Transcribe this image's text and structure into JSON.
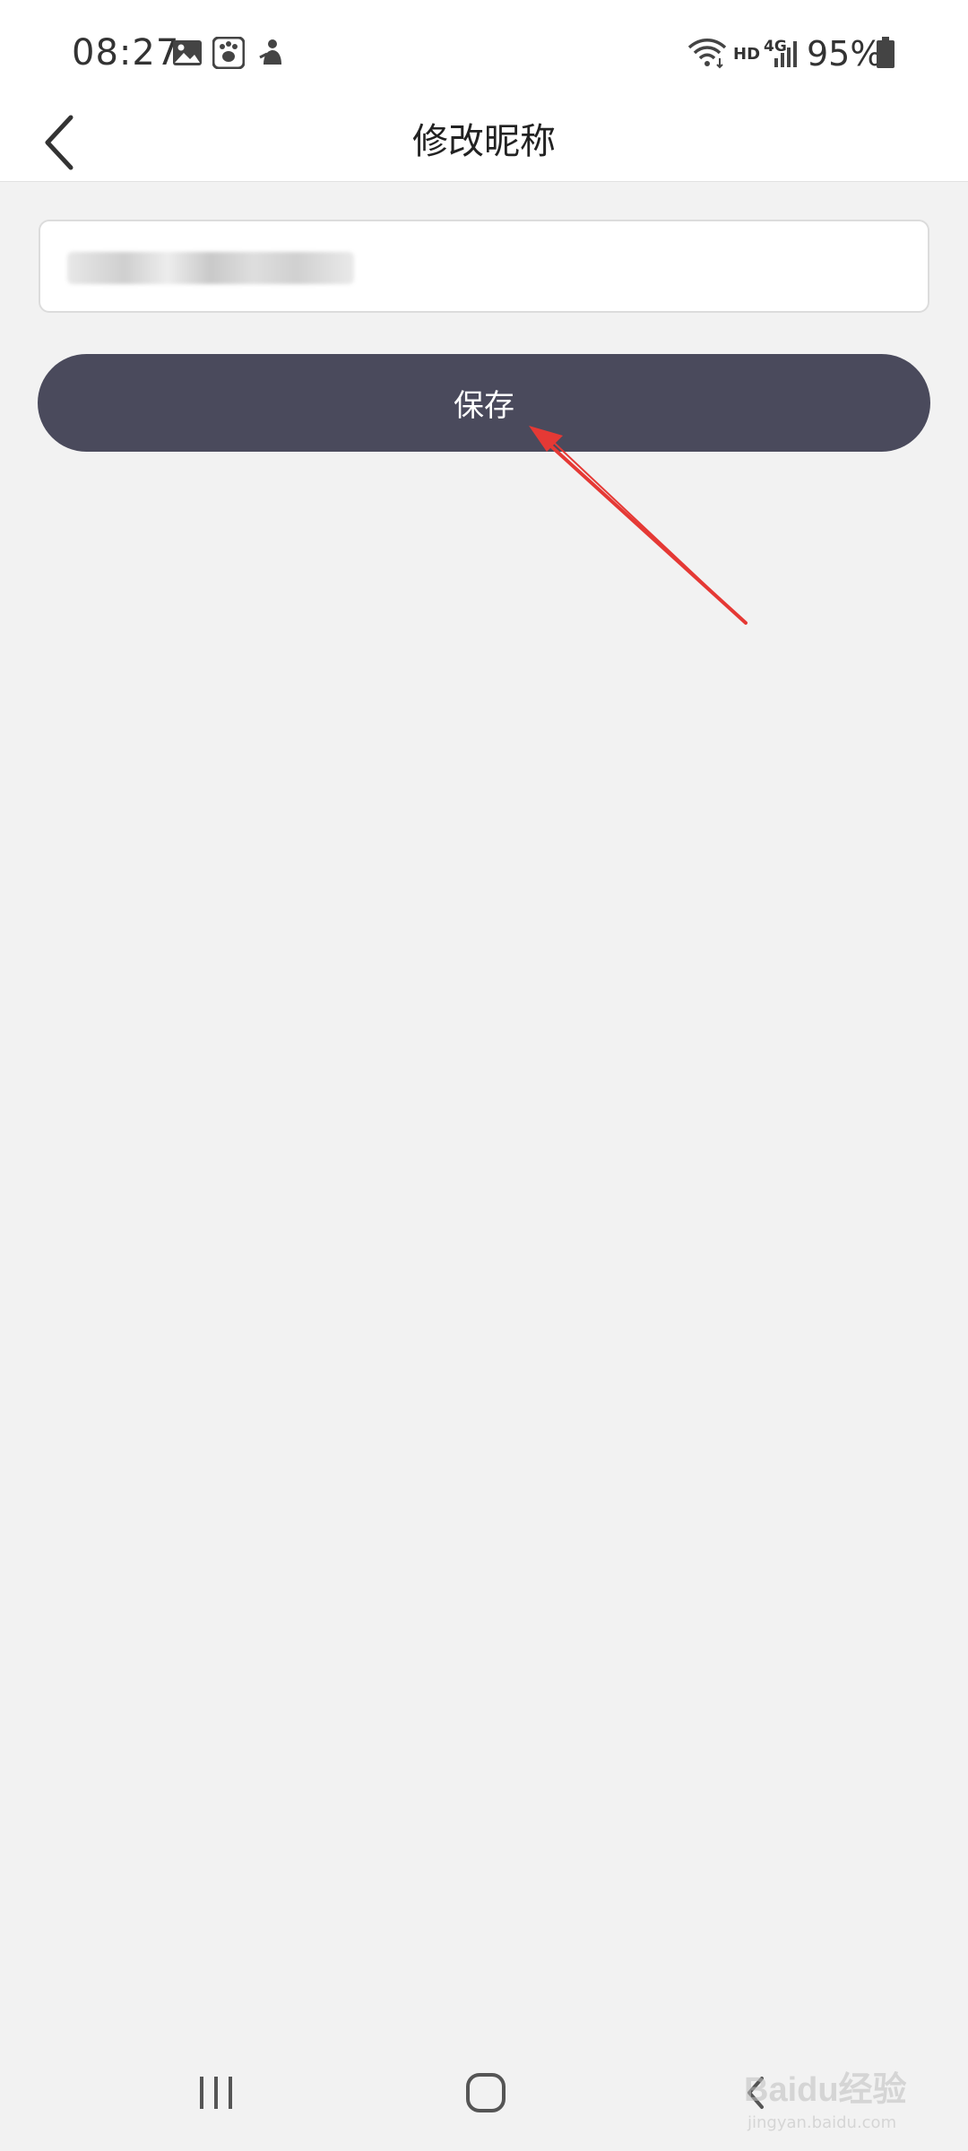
{
  "status_bar": {
    "time": "08:27",
    "hd_label": "HD",
    "network_label": "4G",
    "battery_percent": "95%",
    "icons": [
      "image-icon",
      "baidu-paw-icon",
      "app-notification-icon",
      "wifi-icon",
      "signal-icon",
      "battery-icon"
    ]
  },
  "header": {
    "title": "修改昵称"
  },
  "form": {
    "nickname_value_blurred": true,
    "save_label": "保存"
  },
  "nav_bar": {
    "icons": [
      "recents-icon",
      "home-icon",
      "back-icon"
    ]
  },
  "watermark": {
    "main": "Baidu经验",
    "sub": "jingyan.baidu.com"
  },
  "colors": {
    "background": "#f2f2f2",
    "button": "#4a4a5c",
    "annotation": "#e53935"
  }
}
